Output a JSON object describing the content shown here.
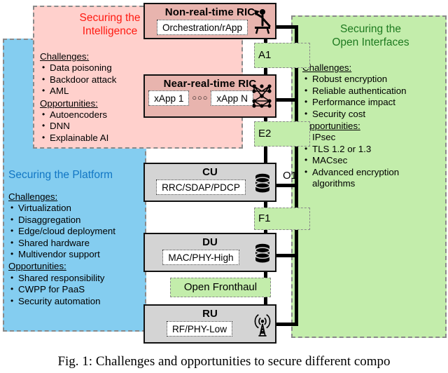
{
  "figure": {
    "caption": "Fig. 1: Challenges and opportunities to secure different compo"
  },
  "regions": {
    "intelligence": {
      "title": "Securing the\nIntelligence",
      "color": "#ff1a11",
      "fill": "#ffd0cc",
      "challenges_label": "Challenges:",
      "challenges": [
        "Data poisoning",
        "Backdoor attack",
        "AML"
      ],
      "opportunities_label": "Opportunities:",
      "opportunities": [
        "Autoencoders",
        "DNN",
        "Explainable AI"
      ]
    },
    "open_interfaces": {
      "title": "Securing the\nOpen Interfaces",
      "color": "#1e7a20",
      "fill": "#c3edab",
      "challenges_label": "Challenges:",
      "challenges": [
        "Robust encryption",
        "Reliable authentication",
        "Performance impact",
        "Security cost"
      ],
      "opportunities_label": "Opportunities:",
      "opportunities": [
        "IPsec",
        "TLS 1.2 or 1.3",
        "MACsec",
        "Advanced encryption algorithms"
      ]
    },
    "platform": {
      "title": "Securing the Platform",
      "color": "#1176c4",
      "fill": "#84cdf0",
      "challenges_label": "Challenges:",
      "challenges": [
        "Virtualization",
        "Disaggregation",
        "Edge/cloud deployment",
        "Shared hardware",
        "Multivendor support"
      ],
      "opportunities_label": "Opportunities:",
      "opportunities": [
        "Shared responsibility",
        "CWPP for PaaS",
        "Security automation"
      ]
    }
  },
  "blocks": [
    {
      "id": "non-rt-ric",
      "title": "Non-real-time RIC",
      "inner": "Orchestration/rApp",
      "icon": "presenter-icon"
    },
    {
      "id": "near-rt-ric",
      "title": "Near-real-time RIC",
      "inner_left": "xApp 1",
      "inner_dots": "○○○",
      "inner_right": "xApp N",
      "icon": "neural-network-icon"
    },
    {
      "id": "cu",
      "title": "CU",
      "inner": "RRC/SDAP/PDCP",
      "icon": "database-icon"
    },
    {
      "id": "du",
      "title": "DU",
      "inner": "MAC/PHY-High",
      "icon": "database-icon"
    },
    {
      "id": "ru",
      "title": "RU",
      "inner": "RF/PHY-Low",
      "icon": "antenna-tower-icon"
    }
  ],
  "interfaces": {
    "a1": "A1",
    "e2": "E2",
    "o1": "O1",
    "f1": "F1",
    "fronthaul": "Open Fronthaul"
  }
}
